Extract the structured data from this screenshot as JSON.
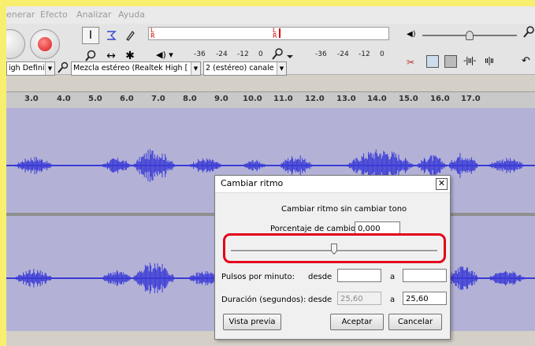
{
  "menu": {
    "items": [
      "enerar",
      "Efecto",
      "Analizar",
      "Ayuda"
    ]
  },
  "meters": {
    "playback_scale": [
      "-36",
      "-24",
      "-12",
      "0"
    ],
    "record_scale": [
      "-36",
      "-24",
      "-12",
      "0"
    ],
    "l_label": "L",
    "r_label": "R"
  },
  "devices": {
    "host": "igh Defini",
    "input": "Mezcla estéreo (Realtek High [",
    "channels": "2 (estéreo) canale"
  },
  "ruler": {
    "ticks": [
      "3.0",
      "4.0",
      "5.0",
      "6.0",
      "7.0",
      "8.0",
      "9.0",
      "10.0",
      "11.0",
      "12.0",
      "13.0",
      "14.0",
      "15.0",
      "16.0",
      "17.0"
    ]
  },
  "dialog": {
    "title": "Cambiar ritmo",
    "heading": "Cambiar ritmo sin cambiar tono",
    "percent_label": "Porcentaje de cambio:",
    "percent_value": "0,000",
    "slider_value": 0.5,
    "bpm_label": "Pulsos por minuto:",
    "from_label": "desde",
    "to_label": "a",
    "bpm_from": "",
    "bpm_to": "",
    "duration_label": "Duración (segundos):",
    "duration_from": "25,60",
    "duration_to": "25,60",
    "preview_button": "Vista previa",
    "ok_button": "Aceptar",
    "cancel_button": "Cancelar"
  },
  "colors": {
    "waveform": "#3a3ad6",
    "track_bg": "#b3b2d6",
    "highlight": "#e3001b",
    "background": "#f7ef6d"
  }
}
